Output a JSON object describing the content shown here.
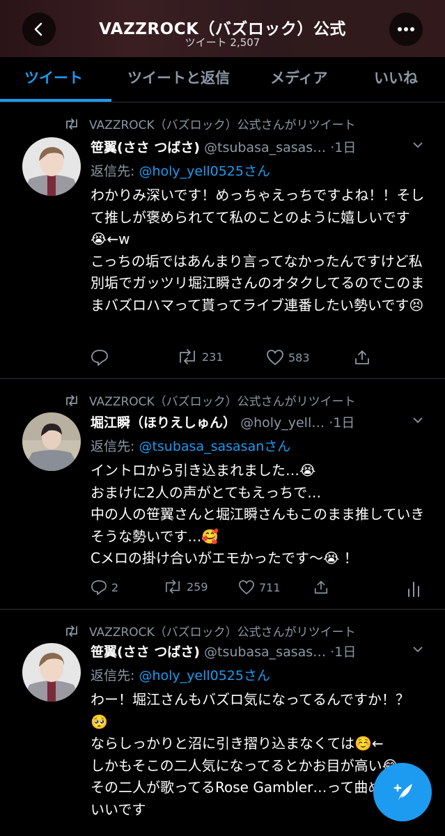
{
  "header": {
    "title": "VAZZROCK（バズロック）公式",
    "subtitle": "ツイート 2,507"
  },
  "tabs": [
    "ツイート",
    "ツイートと返信",
    "メディア",
    "いいね"
  ],
  "tweets": [
    {
      "retweet_label": "VAZZROCK（バズロック）公式さんがリツイート",
      "name": "笹翼(ささ つばさ)",
      "handle": "@tsubasa_sasas…",
      "time": "·1日",
      "reply_prefix": "返信先: ",
      "reply_to": "@holy_yell0525さん",
      "text": "わかりみ深いです！めっちゃえっちですよね！！そして推しが褒められてて私のことのように嬉しいです😭←w\nこっちの垢ではあんまり言ってなかったんですけど私別垢でガッツリ堀江瞬さんのオタクしてるのでこのままバズロハマって貰ってライブ連番したい勢いです😣",
      "replies": "",
      "retweets": "231",
      "likes": "583"
    },
    {
      "retweet_label": "VAZZROCK（バズロック）公式さんがリツイート",
      "name": "堀江瞬（ほりえしゅん）",
      "handle": "@holy_yell…",
      "time": "·1日",
      "reply_prefix": "返信先: ",
      "reply_to": "@tsubasa_sasasanさん",
      "text": "イントロから引き込まれました…😭\nおまけに2人の声がとてもえっちで…\n中の人の笹翼さんと堀江瞬さんもこのまま推していきそうな勢いです…🥰\nCメロの掛け合いがエモかったです〜😭 ！",
      "replies": "2",
      "retweets": "259",
      "likes": "711"
    },
    {
      "retweet_label": "VAZZROCK（バズロック）公式さんがリツイート",
      "name": "笹翼(ささ つばさ)",
      "handle": "@tsubasa_sasas…",
      "time": "·1日",
      "reply_prefix": "返信先: ",
      "reply_to": "@holy_yell0525さん",
      "text": "わー！堀江さんもバズロ気になってるんですか！？🥺\nならしっかりと沼に引き摺り込まなくては☺️←\nしかもそこの二人気になってるとかお目が高い😂\nその二人が歌ってるRose Gambler…って曲めっちゃいいです",
      "replies": "",
      "retweets": "",
      "likes": ""
    }
  ],
  "colors": {
    "accent": "#1d9bf0",
    "muted": "#8b98a5",
    "background": "#000000"
  }
}
